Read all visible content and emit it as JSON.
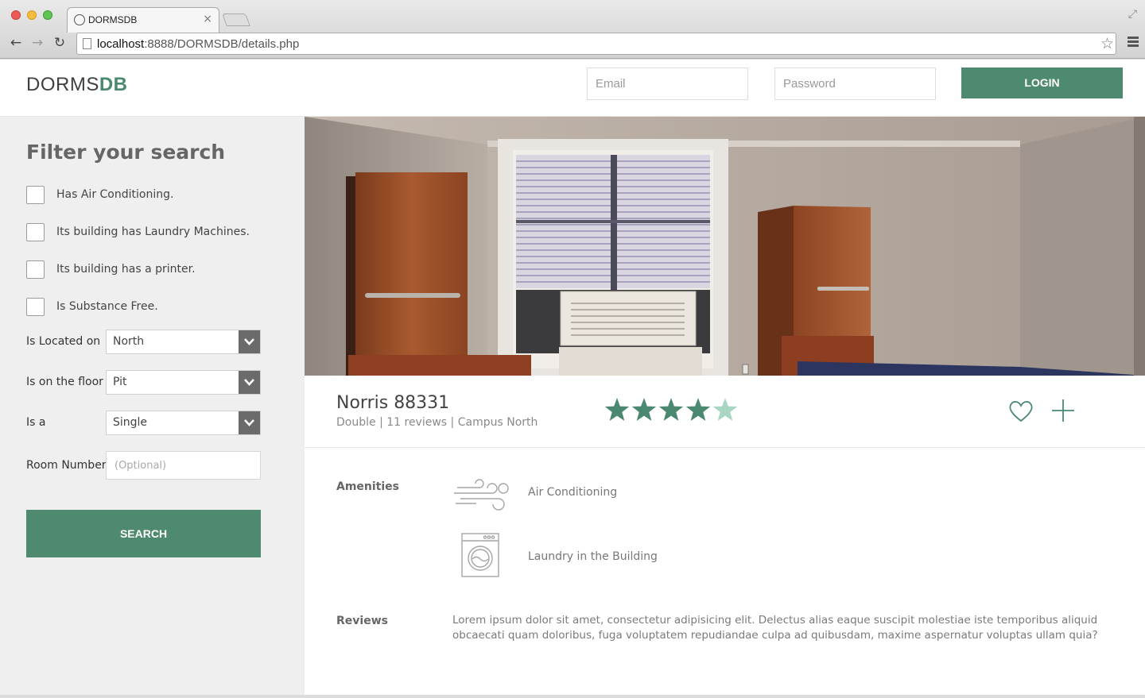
{
  "browser": {
    "tab_title": "DORMSDB",
    "url_prefix": "localhost",
    "url_rest": ":8888/DORMSDB/details.php"
  },
  "header": {
    "logo_light": "DORMS",
    "logo_bold": "DB",
    "email_placeholder": "Email",
    "password_placeholder": "Password",
    "login_label": "LOGIN"
  },
  "sidebar": {
    "title": "Filter your search",
    "checkboxes": [
      {
        "label": "Has Air Conditioning.",
        "checked": false
      },
      {
        "label": "Its building has Laundry Machines.",
        "checked": false
      },
      {
        "label": "Its building has a printer.",
        "checked": false
      },
      {
        "label": "Is Substance Free.",
        "checked": false
      }
    ],
    "selects": [
      {
        "label": "Is Located on",
        "value": "North"
      },
      {
        "label": "Is on the floor",
        "value": "Pit"
      },
      {
        "label": "Is a",
        "value": "Single"
      }
    ],
    "room_number": {
      "label": "Room Number",
      "placeholder": "(Optional)"
    },
    "search_label": "SEARCH"
  },
  "details": {
    "name": "Norris 88331",
    "room_type": "Double",
    "reviews_count": "11 reviews",
    "campus": "Campus North",
    "rating": 4,
    "rating_max": 5,
    "amenities_label": "Amenities",
    "amenities": [
      {
        "icon": "wind-icon",
        "label": "Air Conditioning"
      },
      {
        "icon": "washing-machine-icon",
        "label": "Laundry in the Building"
      }
    ],
    "reviews_label": "Reviews",
    "review_text": "Lorem ipsum dolor sit amet, consectetur adipisicing elit. Delectus alias eaque suscipit molestiae iste temporibus aliquid obcaecati quam doloribus, fuga voluptatem repudiandae culpa ad quibusdam, maxime aspernatur voluptas ullam quia?"
  },
  "colors": {
    "accent": "#4e8a70",
    "star_filled": "#4a8870",
    "star_empty": "#a9d6c3"
  }
}
